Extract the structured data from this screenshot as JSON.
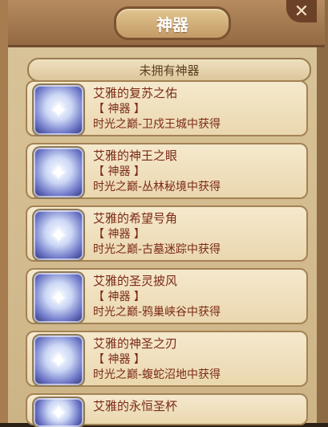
{
  "header": {
    "title": "神器",
    "close_icon_label": "✕"
  },
  "section": {
    "label": "未拥有神器"
  },
  "items": [
    {
      "name": "艾雅的复苏之佑",
      "tag": "【 神器 】",
      "source": "时光之巅-卫戍王城中获得",
      "icon": "wing-chest-icon"
    },
    {
      "name": "艾雅的神王之眼",
      "tag": "【 神器 】",
      "source": "时光之巅-丛林秘境中获得",
      "icon": "eye-crest-icon"
    },
    {
      "name": "艾雅的希望号角",
      "tag": "【 神器 】",
      "source": "时光之巅-古墓迷踪中获得",
      "icon": "horn-icon"
    },
    {
      "name": "艾雅的圣灵披风",
      "tag": "【 神器 】",
      "source": "时光之巅-鸦巢峡谷中获得",
      "icon": "cape-icon"
    },
    {
      "name": "艾雅的神圣之刃",
      "tag": "【 神器 】",
      "source": "时光之巅-蝮蛇沼地中获得",
      "icon": "blade-icon"
    },
    {
      "name": "艾雅的永恒圣杯",
      "tag": "",
      "source": "",
      "icon": "chalice-icon"
    }
  ]
}
